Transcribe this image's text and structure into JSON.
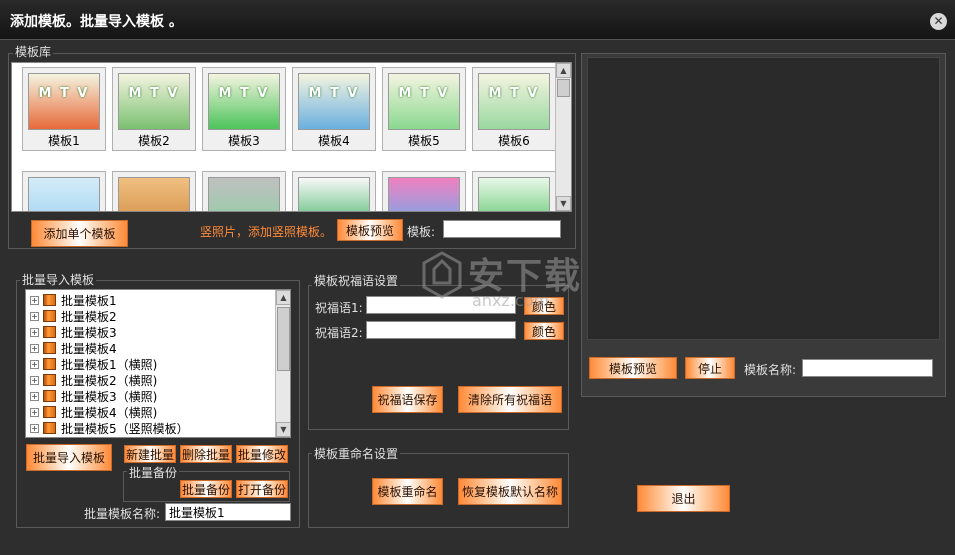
{
  "window": {
    "title": "添加模板。批量导入模板 。"
  },
  "library": {
    "label": "模板库",
    "templates": [
      {
        "name": "模板1",
        "color": "#e86a3a"
      },
      {
        "name": "模板2",
        "color": "#7ac070"
      },
      {
        "name": "模板3",
        "color": "#4cc45a"
      },
      {
        "name": "模板4",
        "color": "#6ab0e0"
      },
      {
        "name": "模板5",
        "color": "#8ad890"
      },
      {
        "name": "模板6",
        "color": "#9ad8a0"
      }
    ],
    "thumb_text": "M T V",
    "add_single_button": "添加单个模板",
    "hint": "竖照片，添加竖照模板。",
    "preview_button": "模板预览",
    "template_label": "模板:",
    "template_value": ""
  },
  "batch": {
    "label": "批量导入模板",
    "items": [
      "批量模板1",
      "批量模板2",
      "批量模板3",
      "批量模板4",
      "批量模板1（横照)",
      "批量模板2（横照)",
      "批量模板3（横照)",
      "批量模板4（横照)",
      "批量模板5（竖照模板）"
    ],
    "import_button": "批量导入模板",
    "new_button": "新建批量",
    "delete_button": "删除批量",
    "modify_button": "批量修改",
    "backup_group": "批量备份",
    "backup_button": "批量备份",
    "open_backup_button": "打开备份",
    "name_label": "批量模板名称:",
    "name_value": "批量模板1"
  },
  "blessing": {
    "label": "模板祝福语设置",
    "line1_label": "祝福语1:",
    "line1_value": "",
    "line2_label": "祝福语2:",
    "line2_value": "",
    "color_button": "颜色",
    "save_button": "祝福语保存",
    "clear_button": "清除所有祝福语"
  },
  "rename": {
    "label": "模板重命名设置",
    "rename_button": "模板重命名",
    "restore_button": "恢复模板默认名称"
  },
  "preview": {
    "preview_button": "模板预览",
    "stop_button": "停止",
    "name_label": "模板名称:",
    "name_value": ""
  },
  "exit_button": "退出",
  "watermark": {
    "brand": "安下载",
    "domain": "anxz.com"
  }
}
